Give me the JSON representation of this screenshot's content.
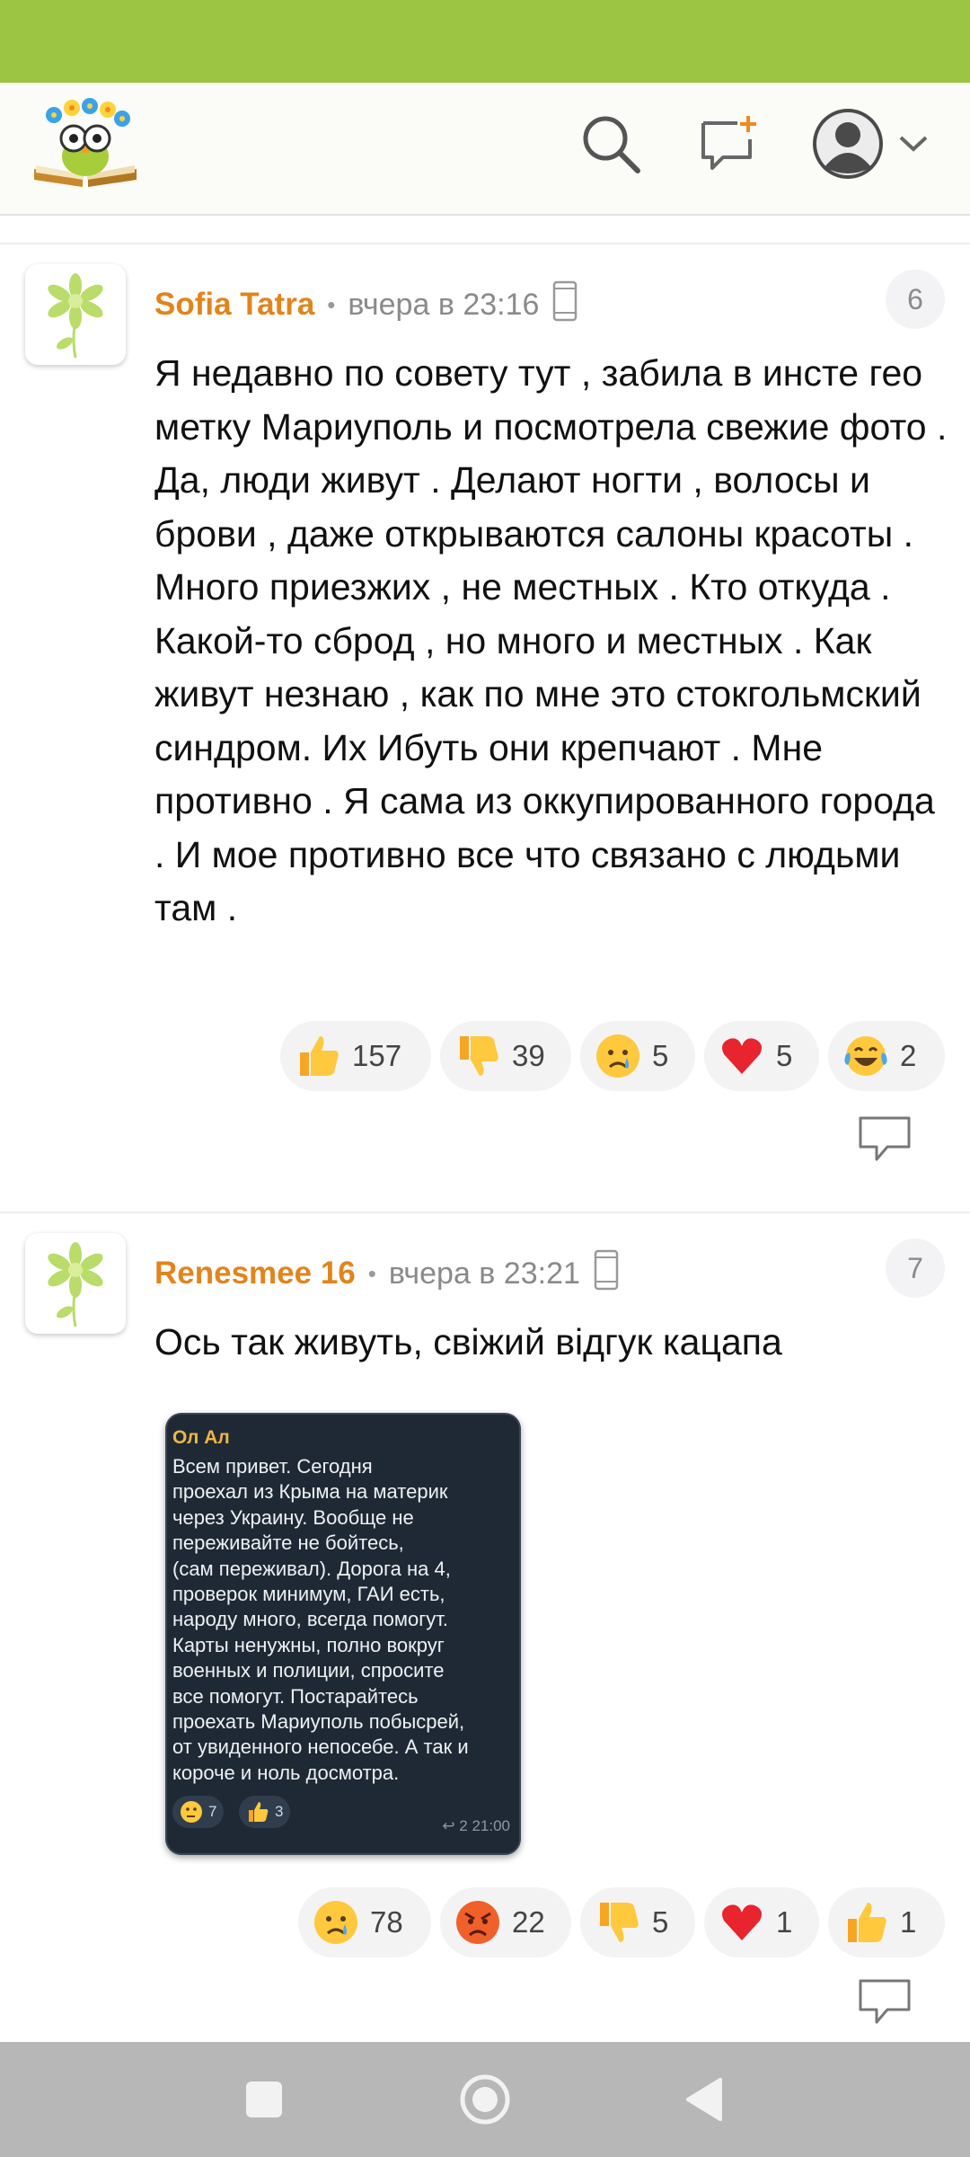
{
  "colors": {
    "status_bar": "#9dc544",
    "author": "#e2841c",
    "navbar": "#b7b7b7"
  },
  "header": {
    "logo_icon": "book-owl-logo",
    "search_icon": "search-icon",
    "new_post_icon": "chat-plus-icon",
    "profile_icon": "avatar-icon"
  },
  "comments": [
    {
      "author": "Sofia Tatra",
      "time": "вчера в 23:16",
      "number": "6",
      "text": "Я недавно по совету тут , забила в инсте гео метку Мариуполь и посмотрела свежие фото . Да, люди живут . Делают ногти , волосы и брови , даже открываются салоны красоты . Много приезжих , не местных . Кто откуда . Какой-то сброд , но много и местных . Как живут незнаю , как по мне это стокгольмский синдром. Их Ибуть они крепчают . Мне противно . Я сама из оккупированного города . И мое противно все что связано с людьми там .",
      "reactions": [
        {
          "emoji": "thumbs-up",
          "count": "157"
        },
        {
          "emoji": "thumbs-down",
          "count": "39"
        },
        {
          "emoji": "crying-face",
          "count": "5"
        },
        {
          "emoji": "red-heart",
          "count": "5"
        },
        {
          "emoji": "tears-of-joy",
          "count": "2"
        }
      ]
    },
    {
      "author": "Renesmee 16",
      "time": "вчера в 23:21",
      "number": "7",
      "text": "Ось так живуть, свіжий відгук кацапа",
      "attachment": {
        "name": "Ол Ал",
        "text": "Всем привет. Сегодня\nпроехал из Крыма на материк\nчерез Украину. Вообще не\nпереживайте   не бойтесь,\n(сам переживал). Дорога на 4,\nпроверок минимум, ГАИ есть,\nнароду много, всегда помогут.\nКарты ненужны, полно вокруг\nвоенных и полиции, спросите\nвсе помогут. Постарайтесь\nпроехать Мариуполь побысрей,\nот увиденного непосебе. А так и\nкороче и ноль досмотра.",
        "reactions": [
          {
            "emoji": "thinking-face",
            "count": "7"
          },
          {
            "emoji": "thumbs-up",
            "count": "3"
          }
        ],
        "meta": "↩ 2  21:00"
      },
      "reactions": [
        {
          "emoji": "crying-face",
          "count": "78"
        },
        {
          "emoji": "angry-face",
          "count": "22"
        },
        {
          "emoji": "thumbs-down",
          "count": "5"
        },
        {
          "emoji": "red-heart",
          "count": "1"
        },
        {
          "emoji": "thumbs-up",
          "count": "1"
        }
      ]
    }
  ],
  "navbar": {
    "recent_icon": "square-icon",
    "home_icon": "circle-icon",
    "back_icon": "back-triangle-icon"
  }
}
